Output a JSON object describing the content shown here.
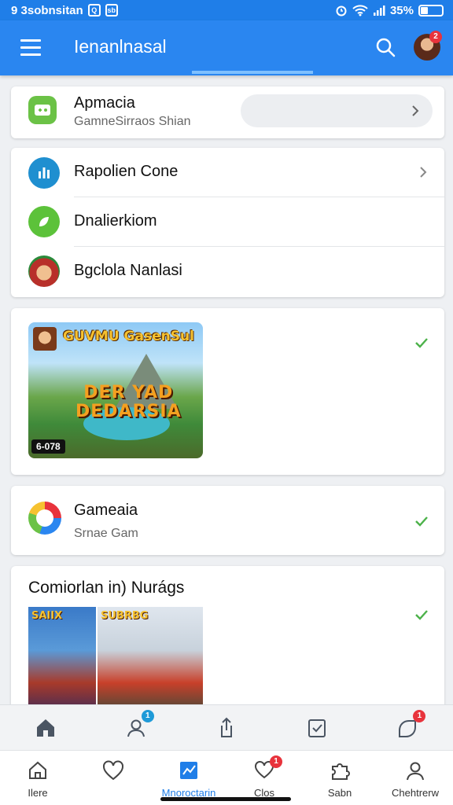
{
  "status_bar": {
    "time_text": "9 3sobnsitan",
    "battery": "35%"
  },
  "app_bar": {
    "title": "Ienanlnasal",
    "avatar_badge": "2"
  },
  "card_top": {
    "title": "Apmacia",
    "subtitle": "GamneSirraos Shian"
  },
  "list": [
    {
      "label": "Rapolien Cone"
    },
    {
      "label": "Dnalierkiom"
    },
    {
      "label": "Bgclola Nanlasi"
    }
  ],
  "game_card": {
    "art_title": "GUVMU GasenSul",
    "logo_line1": "DER    YAD",
    "logo_line2": "DEDARSIA",
    "duration": "6-078"
  },
  "game_card2": {
    "title": "Gameaia",
    "subtitle": "Srnae Gam"
  },
  "section": {
    "title": "Comiorlan in) Nurágs",
    "promo1_label": "SAIIX",
    "promo2_label": "SUBRBG"
  },
  "toolbar": {
    "people_badge": "1",
    "notify_badge": "1"
  },
  "bottom_nav": [
    {
      "label": "Ilere"
    },
    {
      "label": ""
    },
    {
      "label": "Mnoroctarin"
    },
    {
      "label": "Clos",
      "badge": "1"
    },
    {
      "label": "Sabn"
    },
    {
      "label": "Chehtrerw"
    }
  ],
  "colors": {
    "primary": "#2a86f0",
    "accent_green": "#6bc246",
    "badge_red": "#e8333c",
    "check_green": "#4cb24a"
  }
}
